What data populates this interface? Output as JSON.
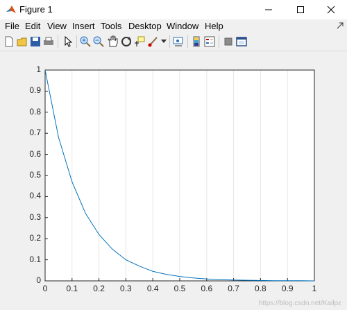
{
  "window": {
    "title": "Figure 1"
  },
  "menu": {
    "items": [
      {
        "label": "File"
      },
      {
        "label": "Edit"
      },
      {
        "label": "View"
      },
      {
        "label": "Insert"
      },
      {
        "label": "Tools"
      },
      {
        "label": "Desktop"
      },
      {
        "label": "Window"
      },
      {
        "label": "Help"
      }
    ]
  },
  "toolbar": {
    "icons": [
      "new-figure-icon",
      "open-file-icon",
      "save-icon",
      "print-icon",
      "pointer-icon",
      "zoom-in-icon",
      "zoom-out-icon",
      "pan-icon",
      "rotate-3d-icon",
      "data-cursor-icon",
      "brush-icon",
      "link-plot-icon",
      "colorbar-icon",
      "legend-icon",
      "hide-plot-tools-icon",
      "show-plot-tools-icon"
    ]
  },
  "chart_data": {
    "type": "line",
    "xlim": [
      0,
      1
    ],
    "ylim": [
      0,
      1
    ],
    "xticks": [
      "0",
      "0.1",
      "0.2",
      "0.3",
      "0.4",
      "0.5",
      "0.6",
      "0.7",
      "0.8",
      "0.9",
      "1"
    ],
    "yticks": [
      "0",
      "0.1",
      "0.2",
      "0.3",
      "0.4",
      "0.5",
      "0.6",
      "0.7",
      "0.8",
      "0.9",
      "1"
    ],
    "grid": "x-only",
    "series": [
      {
        "color": "#0072bd",
        "x": [
          0,
          0.05,
          0.1,
          0.15,
          0.2,
          0.25,
          0.3,
          0.35,
          0.4,
          0.45,
          0.5,
          0.55,
          0.6,
          0.65,
          0.7,
          0.75,
          0.8,
          0.85,
          0.9,
          0.95,
          1
        ],
        "y": [
          1,
          0.68,
          0.47,
          0.32,
          0.22,
          0.15,
          0.1,
          0.07,
          0.045,
          0.031,
          0.021,
          0.014,
          0.009,
          0.006,
          0.004,
          0.003,
          0.002,
          0.001,
          0.001,
          0.0005,
          0
        ]
      }
    ]
  },
  "watermark": "https://blog.csdn.net/Kailpar"
}
